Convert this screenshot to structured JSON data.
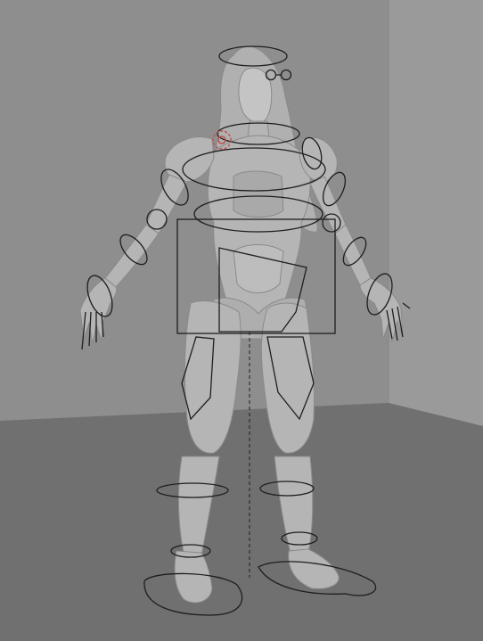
{
  "viewport": {
    "type": "3d-rig-viewport",
    "colors": {
      "back_wall": "#8e8e8e",
      "side_wall": "#9a9a9a",
      "floor": "#6f6f6f",
      "body": "#b7b7b7",
      "body_shadow": "#8c8c8c",
      "controls": "#1e1e1e",
      "selected_control": "#c0504d"
    },
    "controls": [
      {
        "name": "head-control"
      },
      {
        "name": "eye-target-control"
      },
      {
        "name": "neck-control"
      },
      {
        "name": "chest-control"
      },
      {
        "name": "spine-control"
      },
      {
        "name": "hip-control"
      },
      {
        "name": "root-box-control"
      },
      {
        "name": "shoulder-control-left",
        "selected": true
      },
      {
        "name": "shoulder-control-right"
      },
      {
        "name": "upper-arm-control-left"
      },
      {
        "name": "upper-arm-control-right"
      },
      {
        "name": "forearm-control-left"
      },
      {
        "name": "forearm-control-right"
      },
      {
        "name": "hand-control-left"
      },
      {
        "name": "hand-control-right"
      },
      {
        "name": "thigh-control-left"
      },
      {
        "name": "thigh-control-right"
      },
      {
        "name": "knee-control-left"
      },
      {
        "name": "knee-control-right"
      },
      {
        "name": "ankle-control-left"
      },
      {
        "name": "ankle-control-right"
      },
      {
        "name": "foot-control-left"
      },
      {
        "name": "foot-control-right"
      }
    ]
  }
}
